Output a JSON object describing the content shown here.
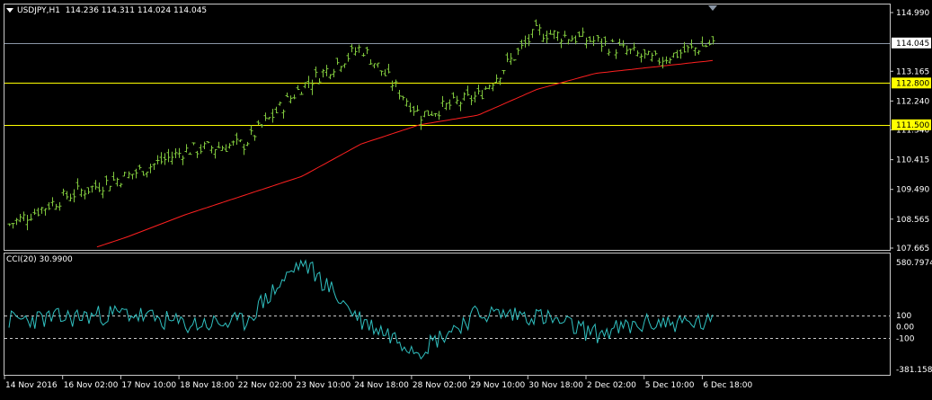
{
  "header": {
    "symbol_tf": "USDJPY,H1",
    "ohlc": "114.236 114.311 114.024 114.045"
  },
  "cci_label": "CCI(20) 30.9900",
  "price_axis": {
    "ticks": [
      "114.990",
      "113.165",
      "112.240",
      "111.340",
      "110.415",
      "109.490",
      "108.565",
      "107.665"
    ],
    "current_price": "114.045",
    "level_labels": [
      "112.800",
      "111.500"
    ]
  },
  "cci_axis": {
    "ticks": [
      "580.7974",
      "100",
      "0.00",
      "-100",
      "-381.1584"
    ]
  },
  "time_axis": {
    "labels": [
      "14 Nov 2016",
      "16 Nov 02:00",
      "17 Nov 10:00",
      "18 Nov 18:00",
      "22 Nov 02:00",
      "23 Nov 10:00",
      "24 Nov 18:00",
      "28 Nov 02:00",
      "29 Nov 10:00",
      "30 Nov 18:00",
      "2 Dec 02:00",
      "5 Dec 10:00",
      "6 Dec 18:00"
    ]
  },
  "levels": [
    {
      "price": 114.045,
      "color": "#8a96a6"
    },
    {
      "price": 112.8,
      "color": "#ffff00"
    },
    {
      "price": 111.5,
      "color": "#ffff00"
    }
  ],
  "colors": {
    "background": "#000000",
    "bars": "#7fc63d",
    "moving_average": "#ff2020",
    "cci_line": "#30c0c0",
    "frame": "#c8c8c8",
    "price_tag_bg": "#ffffff",
    "level_tag_bg": "#ffff00"
  },
  "chart_data": [
    {
      "type": "line",
      "title": "USDJPY,H1",
      "x": [
        "14 Nov 2016",
        "16 Nov 02:00",
        "17 Nov 10:00",
        "18 Nov 18:00",
        "22 Nov 02:00",
        "23 Nov 10:00",
        "24 Nov 18:00",
        "28 Nov 02:00",
        "29 Nov 10:00",
        "30 Nov 18:00",
        "2 Dec 02:00",
        "5 Dec 10:00",
        "6 Dec 18:00"
      ],
      "series": [
        {
          "values": [
            108.4,
            109.3,
            109.9,
            110.7,
            110.9,
            112.7,
            113.9,
            111.8,
            112.4,
            114.4,
            114.1,
            113.5,
            114.045
          ]
        },
        {
          "values": [
            106.9,
            107.4,
            108.0,
            108.7,
            109.3,
            109.9,
            110.9,
            111.5,
            111.8,
            112.6,
            113.1,
            113.3,
            113.5
          ]
        }
      ],
      "ylim": [
        107.665,
        114.99
      ],
      "grid": false
    },
    {
      "type": "line",
      "title": "CCI(20) 30.9900",
      "x": [
        "14 Nov 2016",
        "16 Nov 02:00",
        "17 Nov 10:00",
        "18 Nov 18:00",
        "22 Nov 02:00",
        "23 Nov 10:00",
        "24 Nov 18:00",
        "28 Nov 02:00",
        "29 Nov 10:00",
        "30 Nov 18:00",
        "2 Dec 02:00",
        "5 Dec 10:00",
        "6 Dec 18:00"
      ],
      "series": [
        {
          "values": [
            60,
            80,
            120,
            20,
            40,
            580,
            60,
            -200,
            120,
            100,
            -60,
            40,
            30.99
          ]
        }
      ],
      "ylim": [
        -381.1584,
        580.7974
      ],
      "grid": false
    }
  ]
}
